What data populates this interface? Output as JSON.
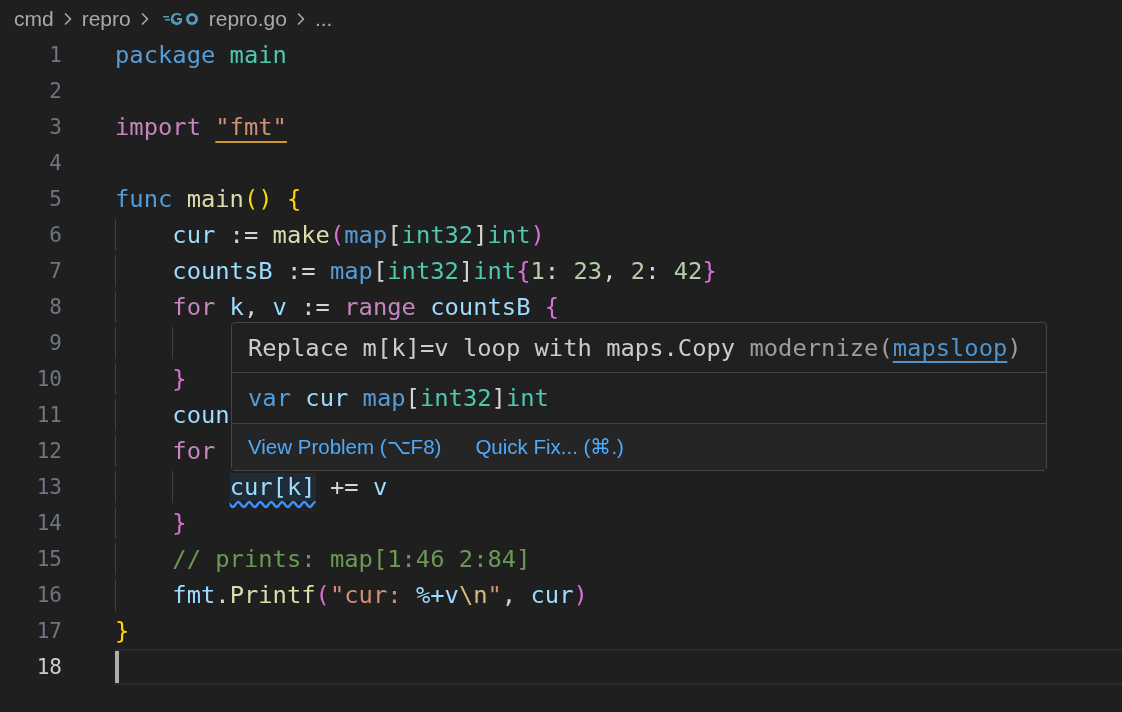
{
  "breadcrumb": {
    "items": [
      {
        "label": "cmd",
        "kind": "folder"
      },
      {
        "label": "repro",
        "kind": "folder"
      },
      {
        "label": "repro.go",
        "kind": "gofile"
      },
      {
        "label": "...",
        "kind": "more"
      }
    ]
  },
  "editor": {
    "lines": [
      {
        "number": "1",
        "current": false,
        "tokens": [
          {
            "text": "package",
            "kind": "storage"
          },
          {
            "text": " main",
            "kind": "type"
          }
        ]
      },
      {
        "number": "2",
        "current": false
      },
      {
        "number": "3",
        "current": false,
        "tokens": [
          {
            "text": "import ",
            "kind": "keyword"
          },
          {
            "text": "\"fmt\"",
            "kind": "string",
            "underline": true
          }
        ]
      },
      {
        "number": "4",
        "current": false
      },
      {
        "number": "5",
        "current": false,
        "tokens": [
          {
            "text": "func",
            "kind": "storage"
          },
          {
            "text": " main",
            "kind": "func"
          },
          {
            "text": "()",
            "kind": "bracket1"
          },
          {
            "text": " {",
            "kind": "bracket1"
          }
        ]
      },
      {
        "number": "6",
        "current": false,
        "guides": [
          {
            "kind": "indent"
          }
        ],
        "tokens": [
          {
            "text": "cur",
            "kind": "var"
          },
          {
            "text": " := ",
            "kind": "plain"
          },
          {
            "text": "make",
            "kind": "func"
          },
          {
            "text": "(",
            "kind": "bracket2"
          },
          {
            "text": "map",
            "kind": "storage"
          },
          {
            "text": "[",
            "kind": "plain"
          },
          {
            "text": "int32",
            "kind": "type"
          },
          {
            "text": "]",
            "kind": "plain"
          },
          {
            "text": "int",
            "kind": "type"
          },
          {
            "text": ")",
            "kind": "bracket2"
          }
        ]
      },
      {
        "number": "7",
        "current": false,
        "guides": [
          {
            "kind": "indent"
          }
        ],
        "tokens": [
          {
            "text": "countsB",
            "kind": "var"
          },
          {
            "text": " := ",
            "kind": "plain"
          },
          {
            "text": "map",
            "kind": "storage"
          },
          {
            "text": "[",
            "kind": "plain"
          },
          {
            "text": "int32",
            "kind": "type"
          },
          {
            "text": "]",
            "kind": "plain"
          },
          {
            "text": "int",
            "kind": "type"
          },
          {
            "text": "{",
            "kind": "bracket2"
          },
          {
            "text": "1",
            "kind": "number"
          },
          {
            "text": ": ",
            "kind": "plain"
          },
          {
            "text": "23",
            "kind": "number"
          },
          {
            "text": ", ",
            "kind": "plain"
          },
          {
            "text": "2",
            "kind": "number"
          },
          {
            "text": ": ",
            "kind": "plain"
          },
          {
            "text": "42",
            "kind": "number"
          },
          {
            "text": "}",
            "kind": "bracket2"
          }
        ]
      },
      {
        "number": "8",
        "current": false,
        "guides": [
          {
            "kind": "indent"
          }
        ],
        "tokens": [
          {
            "text": "for",
            "kind": "keyword"
          },
          {
            "text": " k",
            "kind": "var"
          },
          {
            "text": ", ",
            "kind": "plain"
          },
          {
            "text": "v",
            "kind": "var"
          },
          {
            "text": " := ",
            "kind": "plain"
          },
          {
            "text": "range",
            "kind": "keyword"
          },
          {
            "text": " countsB",
            "kind": "var"
          },
          {
            "text": " {",
            "kind": "bracket2"
          }
        ]
      },
      {
        "number": "9",
        "current": false,
        "guides": [
          {
            "kind": "indent"
          },
          {
            "kind": "indent"
          }
        ]
      },
      {
        "number": "10",
        "current": false,
        "guides": [
          {
            "kind": "indent"
          }
        ],
        "tokens": [
          {
            "text": "}",
            "kind": "bracket2"
          }
        ]
      },
      {
        "number": "11",
        "current": false,
        "guides": [
          {
            "kind": "indent"
          }
        ],
        "tokens": [
          {
            "text": "coun",
            "kind": "var"
          }
        ]
      },
      {
        "number": "12",
        "current": false,
        "guides": [
          {
            "kind": "indent"
          }
        ],
        "tokens": [
          {
            "text": "for",
            "kind": "keyword"
          }
        ]
      },
      {
        "number": "13",
        "current": false,
        "guides": [
          {
            "kind": "indent"
          },
          {
            "kind": "indent"
          }
        ],
        "tokens": [
          {
            "text": "cur[k]",
            "kind": "var",
            "squiggle": true
          },
          {
            "text": " += ",
            "kind": "plain"
          },
          {
            "text": "v",
            "kind": "var"
          }
        ]
      },
      {
        "number": "14",
        "current": false,
        "guides": [
          {
            "kind": "indent"
          }
        ],
        "tokens": [
          {
            "text": "}",
            "kind": "bracket2"
          }
        ]
      },
      {
        "number": "15",
        "current": false,
        "guides": [
          {
            "kind": "indent"
          }
        ],
        "tokens": [
          {
            "text": "// prints: map[1:46 2:84]",
            "kind": "comment"
          }
        ]
      },
      {
        "number": "16",
        "current": false,
        "guides": [
          {
            "kind": "indent"
          }
        ],
        "tokens": [
          {
            "text": "fmt",
            "kind": "var"
          },
          {
            "text": ".",
            "kind": "plain"
          },
          {
            "text": "Printf",
            "kind": "func"
          },
          {
            "text": "(",
            "kind": "bracket2"
          },
          {
            "text": "\"cur: ",
            "kind": "string"
          },
          {
            "text": "%+v",
            "kind": "var"
          },
          {
            "text": "\\n",
            "kind": "escape"
          },
          {
            "text": "\"",
            "kind": "string"
          },
          {
            "text": ", ",
            "kind": "plain"
          },
          {
            "text": "cur",
            "kind": "var"
          },
          {
            "text": ")",
            "kind": "bracket2"
          }
        ]
      },
      {
        "number": "17",
        "current": false,
        "tokens": [
          {
            "text": "}",
            "kind": "bracket1"
          }
        ]
      },
      {
        "number": "18",
        "current": true
      }
    ]
  },
  "hover": {
    "message": "Replace m[k]=v loop with maps.Copy",
    "source": "modernize(",
    "code": "mapsloop",
    "source_end": ")",
    "signature": [
      {
        "text": "var",
        "kind": "storage"
      },
      {
        "text": " cur",
        "kind": "var"
      },
      {
        "text": " map",
        "kind": "storage"
      },
      {
        "text": "[",
        "kind": "plain"
      },
      {
        "text": "int32",
        "kind": "type"
      },
      {
        "text": "]",
        "kind": "plain"
      },
      {
        "text": "int",
        "kind": "type"
      }
    ],
    "actions": [
      {
        "label": "View Problem (⌥F8)"
      },
      {
        "label": "Quick Fix... (⌘.)"
      }
    ]
  }
}
